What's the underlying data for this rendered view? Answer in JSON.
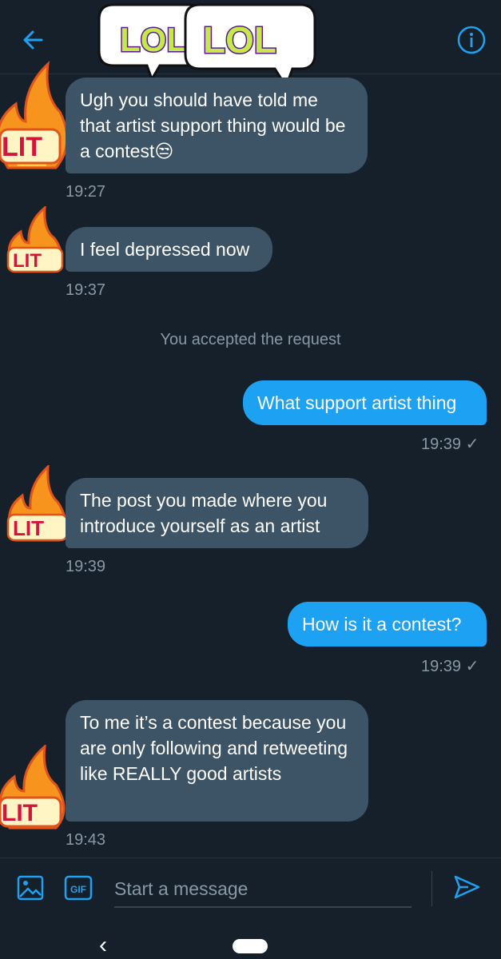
{
  "header": {
    "back_icon": "arrow-left-icon",
    "info_icon": "info-icon",
    "stickers": [
      "LOL",
      "LOL"
    ],
    "accent": "#1da1f2"
  },
  "messages": [
    {
      "type": "received",
      "text": "Ugh you should have told me that artist support thing would be a contest😒",
      "time": "19:27",
      "sticker": "LIT"
    },
    {
      "type": "received",
      "text": "I feel depressed now",
      "time": "19:37",
      "sticker": "LIT"
    },
    {
      "type": "notice",
      "text": "You accepted the request"
    },
    {
      "type": "sent",
      "text": "What support artist thing",
      "time": "19:39 ✓"
    },
    {
      "type": "received",
      "text": "The post you made where you introduce yourself as an artist",
      "time": "19:39",
      "sticker": "LIT"
    },
    {
      "type": "sent",
      "text": "How is it a contest?",
      "time": "19:39 ✓"
    },
    {
      "type": "received",
      "text": "To me it’s a contest because you are only following and retweeting like REALLY good artists",
      "time": "19:43",
      "sticker": "LIT"
    }
  ],
  "composer": {
    "placeholder": "Start a message",
    "image_icon": "image-icon",
    "gif_label": "GIF",
    "send_icon": "send-icon"
  },
  "nav": {
    "back_glyph": "‹"
  },
  "colors": {
    "background": "#15202b",
    "received_bubble": "#3d5466",
    "sent_bubble": "#1da1f2",
    "muted_text": "#8899a6",
    "sticker_text": "#c5e84a",
    "sticker_shadow": "#7b2fb0",
    "lit_text": "#d4143a"
  }
}
